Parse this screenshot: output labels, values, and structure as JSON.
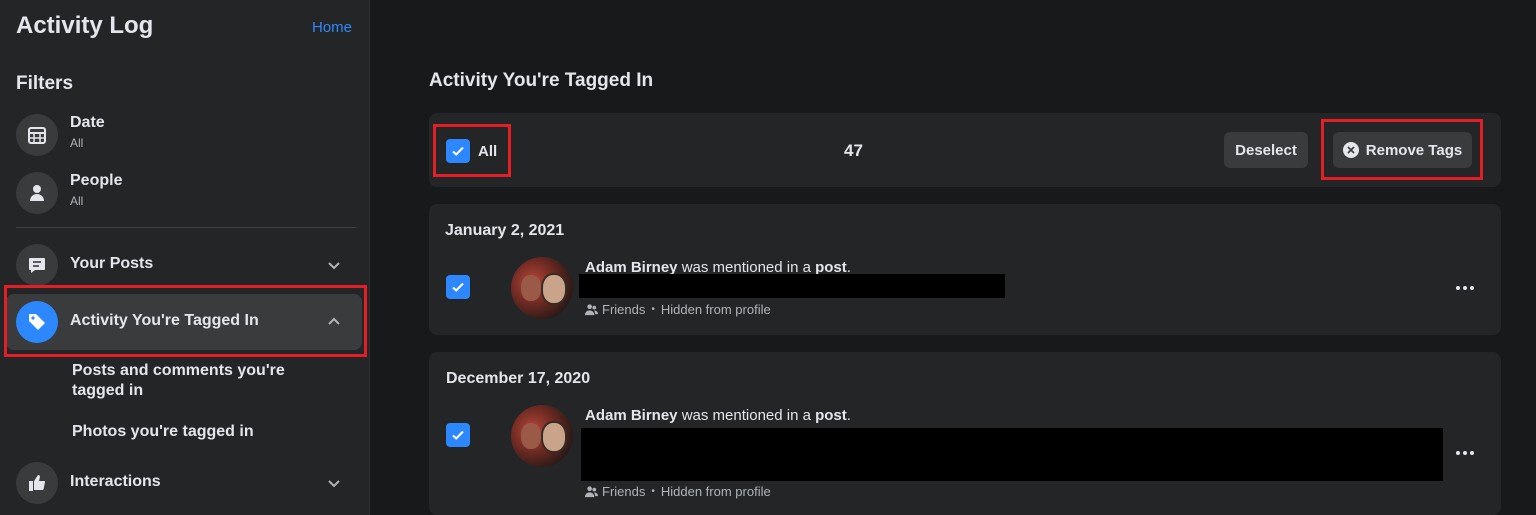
{
  "sidebar": {
    "title": "Activity Log",
    "home_link": "Home",
    "filters_heading": "Filters",
    "filters": [
      {
        "label": "Date",
        "value": "All",
        "icon": "calendar-icon"
      },
      {
        "label": "People",
        "value": "All",
        "icon": "person-icon"
      }
    ],
    "nav": [
      {
        "label": "Your Posts",
        "icon": "posts-icon",
        "expanded": false
      },
      {
        "label": "Activity You're Tagged In",
        "icon": "tag-icon",
        "expanded": true,
        "active": true
      },
      {
        "label": "Interactions",
        "icon": "thumbs-up-icon",
        "expanded": false
      }
    ],
    "subitems": [
      "Posts and comments you're tagged in",
      "Photos you're tagged in"
    ]
  },
  "main": {
    "title": "Activity You're Tagged In",
    "toolbar": {
      "select_all_label": "All",
      "selected_count": "47",
      "deselect_label": "Deselect",
      "remove_tags_label": "Remove Tags"
    },
    "entries": [
      {
        "date": "January 2, 2021",
        "name": "Adam Birney",
        "text_mid": " was mentioned in a ",
        "text_link": "post",
        "text_end": ".",
        "audience": "Friends",
        "visibility": "Hidden from profile",
        "checked": true
      },
      {
        "date": "December 17, 2020",
        "name": "Adam Birney",
        "text_mid": " was mentioned in a ",
        "text_link": "post",
        "text_end": ".",
        "audience": "Friends",
        "visibility": "Hidden from profile",
        "checked": true
      }
    ]
  },
  "colors": {
    "accent": "#2d88ff",
    "highlight": "#e41e26",
    "background": "#18191a",
    "surface": "#242526"
  }
}
